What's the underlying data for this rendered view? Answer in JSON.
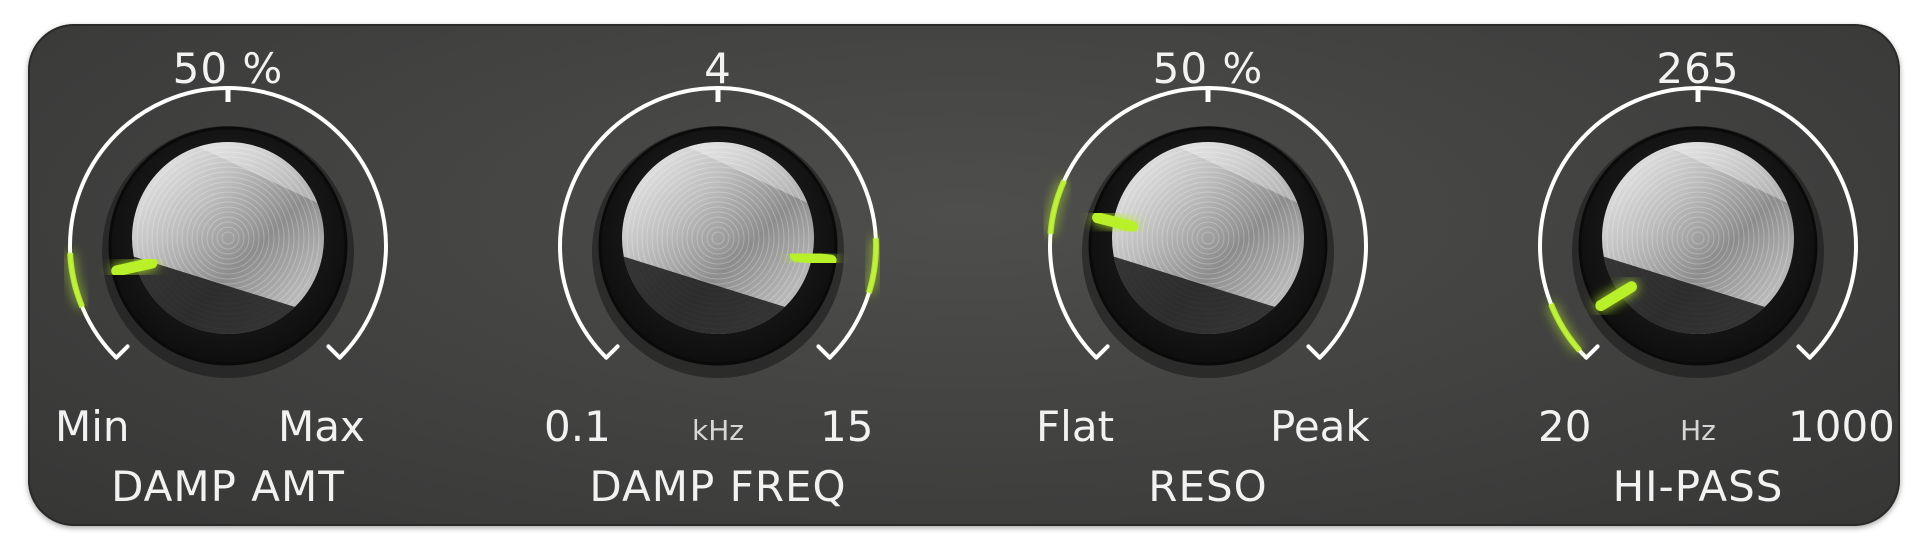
{
  "colors": {
    "panel": "#414140",
    "arc": "#ffffff",
    "indicator": "#b8f02a",
    "text": "#f2f2f2"
  },
  "knobs": [
    {
      "name": "DAMP AMT",
      "value": "50 %",
      "min_label": "Min",
      "max_label": "Max",
      "unit": "",
      "level": 0.12,
      "icon": "knob-icon"
    },
    {
      "name": "DAMP FREQ",
      "value": "4",
      "min_label": "0.1",
      "max_label": "15",
      "unit": "kHz",
      "level": 0.86,
      "icon": "knob-icon"
    },
    {
      "name": "RESO",
      "value": "50 %",
      "min_label": "Flat",
      "max_label": "Peak",
      "unit": "",
      "level": 0.22,
      "icon": "knob-icon"
    },
    {
      "name": "HI-PASS",
      "value": "265",
      "min_label": "20",
      "max_label": "1000",
      "unit": "Hz",
      "level": 0.05,
      "icon": "knob-icon"
    }
  ]
}
